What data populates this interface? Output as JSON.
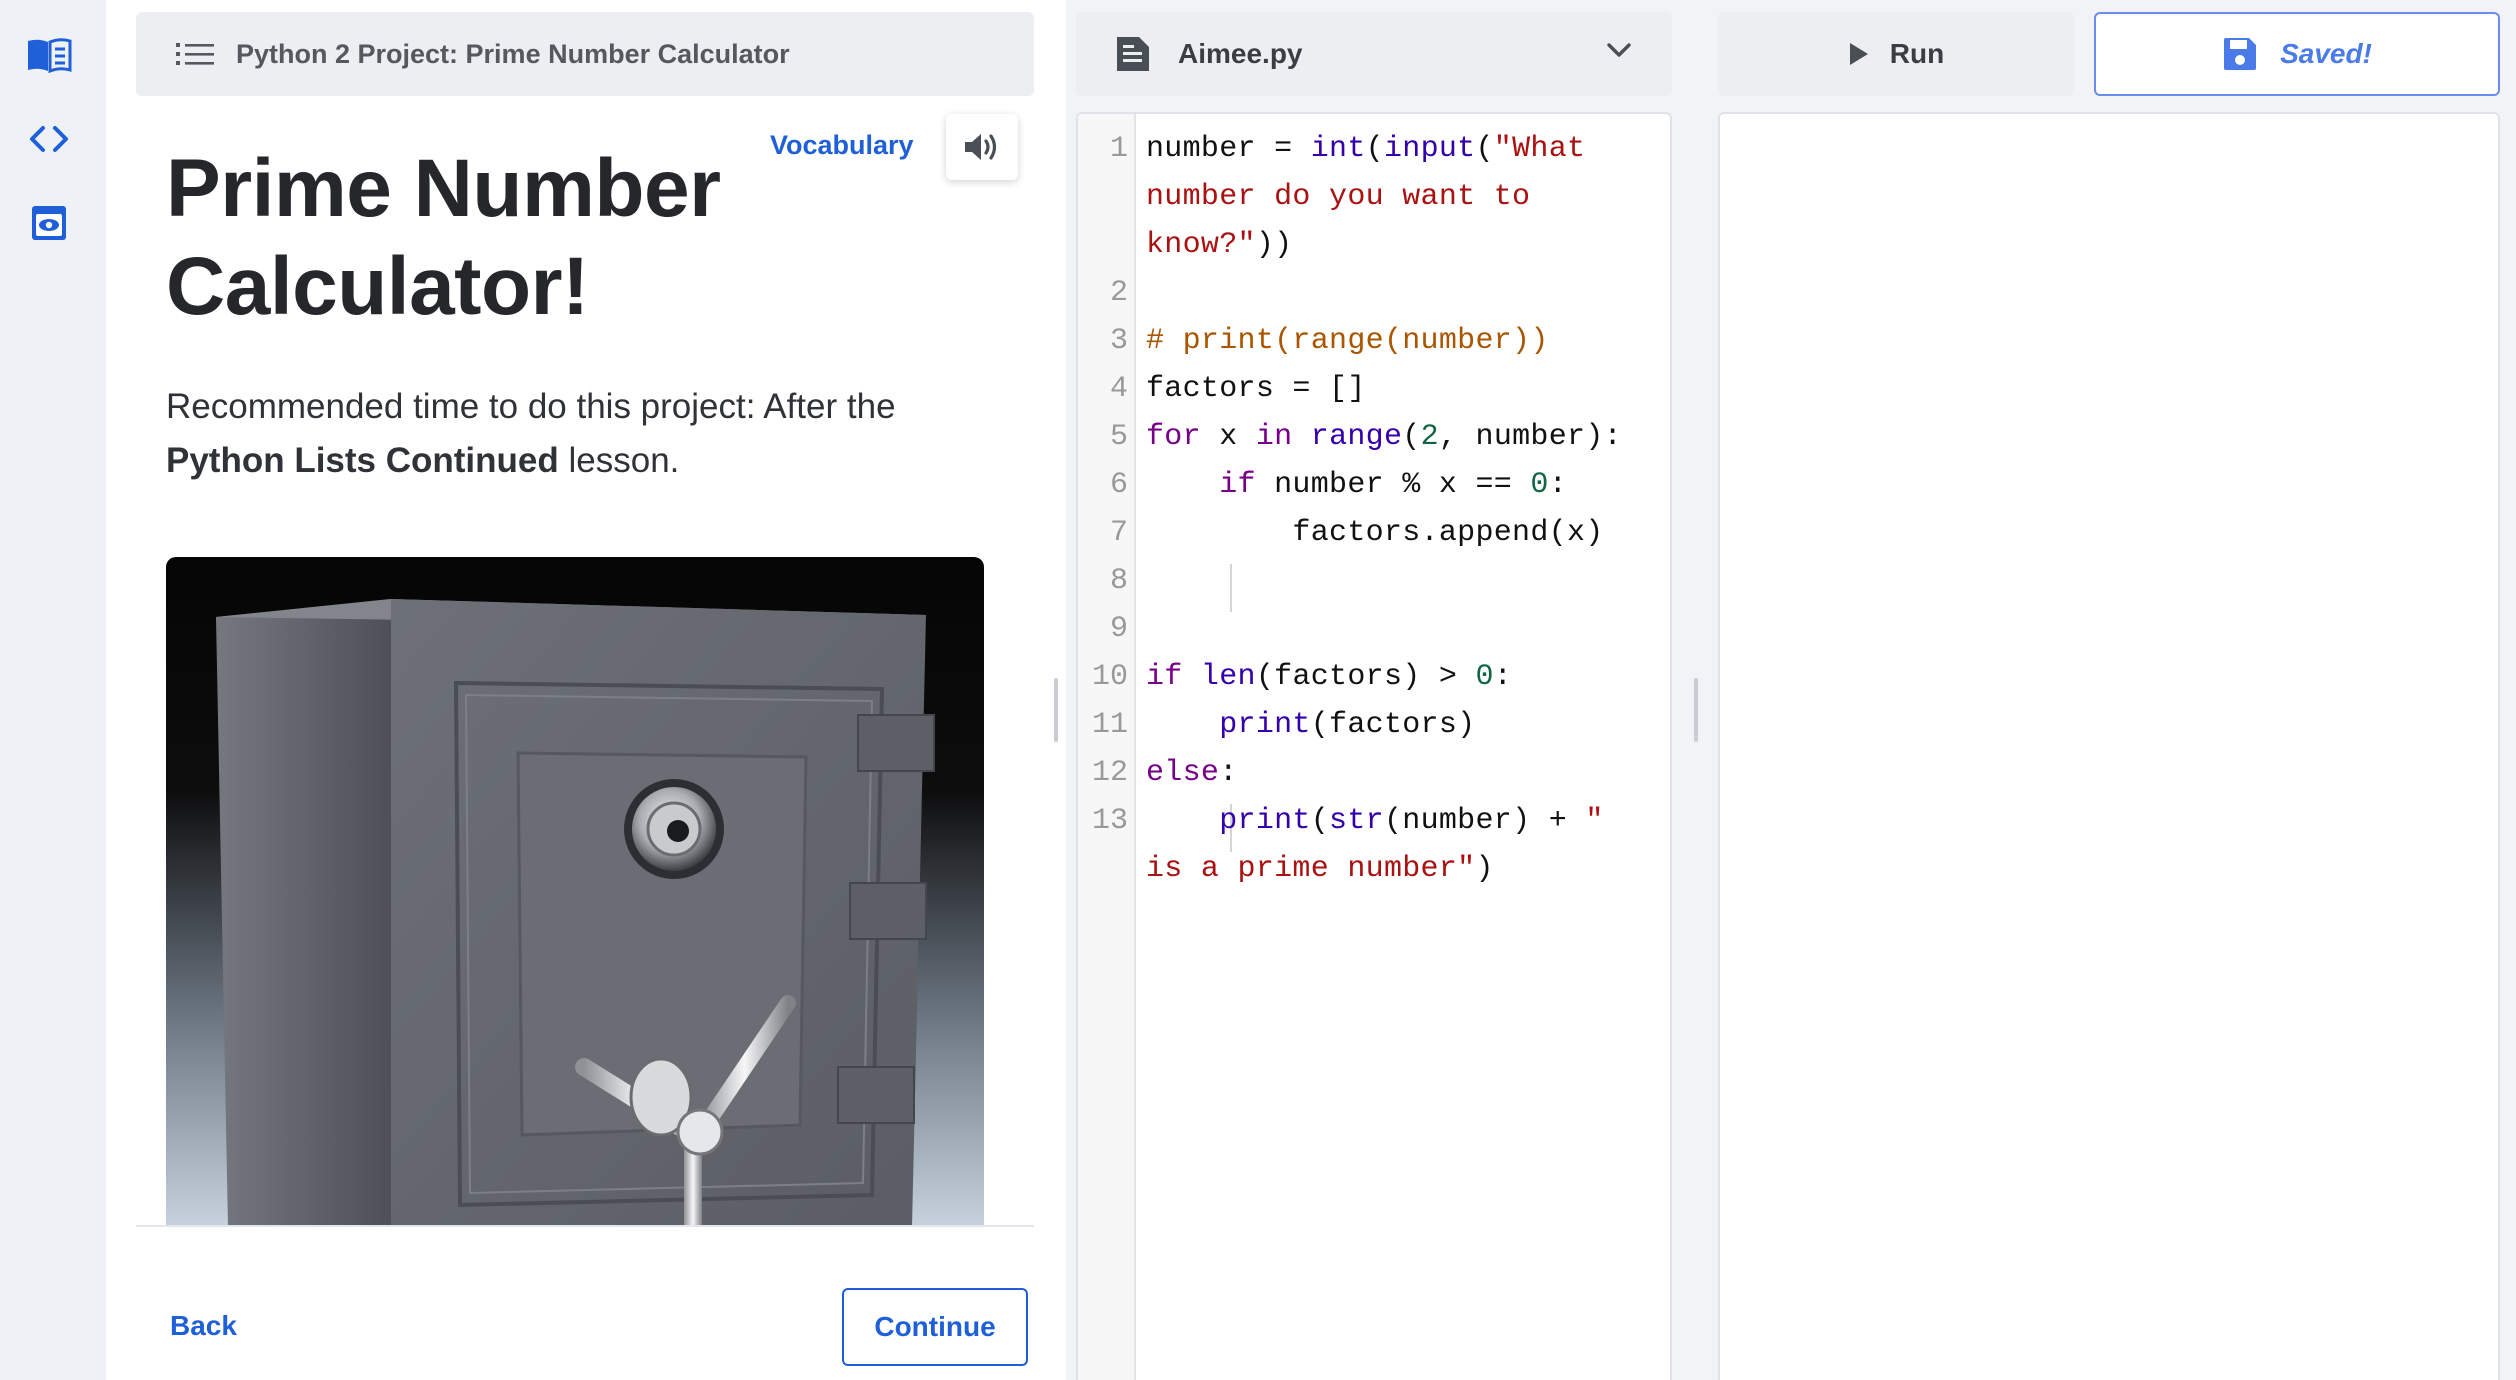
{
  "lesson": {
    "header_title": "Python 2 Project: Prime Number Calculator",
    "vocabulary_label": "Vocabulary",
    "title_line1": "Prime Number",
    "title_line2": "Calculator!",
    "desc_prefix": "Recommended time to do this project: After the ",
    "desc_bold": "Python Lists Continued",
    "desc_suffix": " lesson.",
    "back_label": "Back",
    "continue_label": "Continue"
  },
  "editor": {
    "file_name": "Aimee.py",
    "line_numbers": [
      "1",
      "2",
      "3",
      "4",
      "5",
      "6",
      "7",
      "8",
      "9",
      "10",
      "11",
      "12",
      "13"
    ]
  },
  "toolbar": {
    "run_label": "Run",
    "saved_label": "Saved!"
  },
  "colors": {
    "accent": "#1f5fd8",
    "saved_accent": "#4b7be8",
    "keyword": "#770088",
    "builtin": "#3300aa",
    "string": "#aa1111",
    "number": "#116644",
    "comment": "#aa5500"
  },
  "icons": {
    "rail": [
      "book-icon",
      "code-icon",
      "preview-icon"
    ],
    "lesson_header": "list-menu-icon",
    "speaker": "speaker-icon",
    "file": "file-icon",
    "dropdown": "chevron-down-icon",
    "run": "play-icon",
    "save": "floppy-disk-icon"
  }
}
